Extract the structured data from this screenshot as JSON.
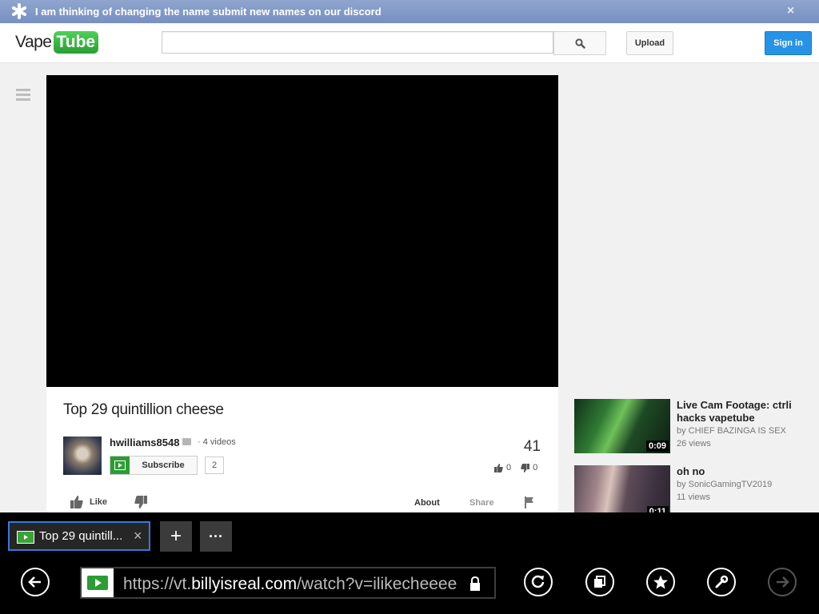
{
  "banner": {
    "message": "I am thinking of changing the name submit new names on our discord",
    "icon": "asterisk-icon",
    "close_label": "×"
  },
  "header": {
    "logo_part1": "Vape",
    "logo_part2": "Tube",
    "search_value": "",
    "upload_label": "Upload",
    "signin_label": "Sign in"
  },
  "video": {
    "title": "Top 29 quintillion cheese",
    "channel": "hwilliams8548",
    "video_count": "· 4 videos",
    "subscribe_label": "Subscribe",
    "subscriber_count": "2",
    "views": "41",
    "likes": "0",
    "dislikes": "0",
    "like_label": "Like",
    "about_label": "About",
    "share_label": "Share"
  },
  "related": [
    {
      "title": "Live Cam Footage: ctrli hacks vapetube",
      "by": "by CHIEF BAZINGA IS SEX",
      "views": "26 views",
      "duration": "0:09"
    },
    {
      "title": "oh no",
      "by": "by SonicGamingTV2019",
      "views": "11 views",
      "duration": "0:11"
    }
  ],
  "browser": {
    "tab_label": "Top 29 quintill...",
    "tab_close": "×",
    "new_tab": "+",
    "more": "···",
    "url_prefix": "https://vt.",
    "url_domain": "billyisreal.com",
    "url_path": "/watch?v=ilikecheeee"
  },
  "colors": {
    "accent_blue": "#2793e6",
    "brand_green": "#2b9d33",
    "banner_blue": "#7f96c6"
  }
}
